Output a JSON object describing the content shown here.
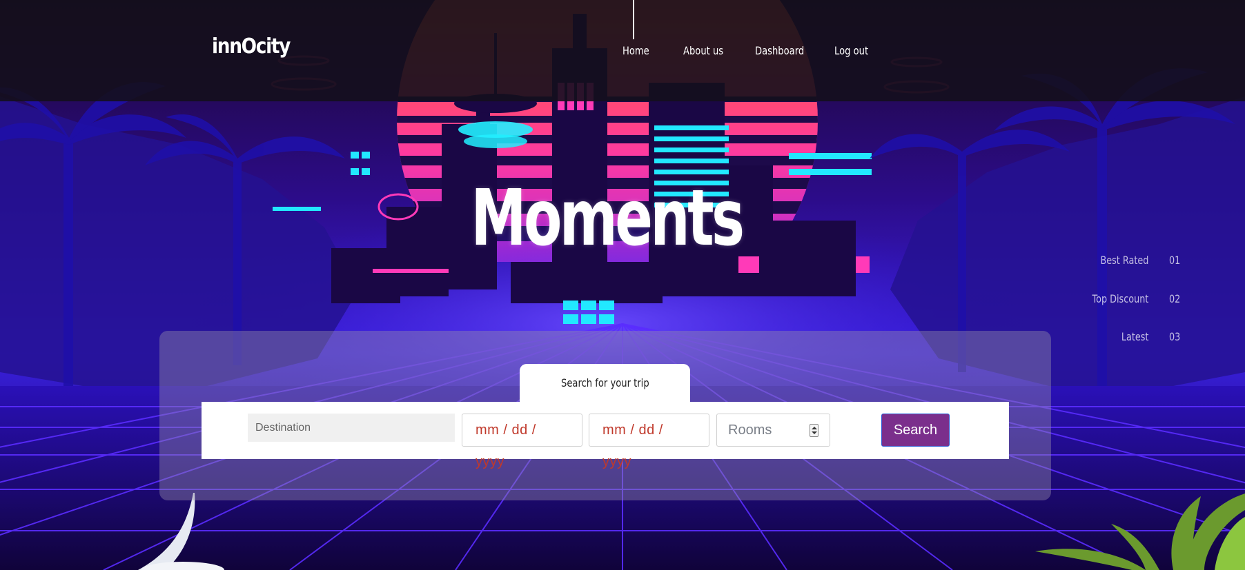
{
  "brand": "innOcity",
  "nav": {
    "items": [
      {
        "label": "Home",
        "active": true
      },
      {
        "label": "About us"
      },
      {
        "label": "Dashboard"
      },
      {
        "label": "Log out"
      }
    ]
  },
  "hero": {
    "title": "Moments"
  },
  "side_list": [
    {
      "label": "Best Rated",
      "num": "01"
    },
    {
      "label": "Top Discount",
      "num": "02"
    },
    {
      "label": "Latest",
      "num": "03"
    }
  ],
  "search": {
    "tab_label": "Search for your trip",
    "destination_placeholder": "Destination",
    "checkin_value": "mm / dd / yyyy",
    "checkout_value": "mm / dd / yyyy",
    "rooms_placeholder": "Rooms",
    "button_label": "Search"
  },
  "colors": {
    "navbar": "#14101c",
    "accent_button": "#7b2f8c",
    "date_text": "#c0392b",
    "sky_top": "#1a0730",
    "sky_bottom": "#2a0fcf",
    "grid": "#5a2cff"
  }
}
